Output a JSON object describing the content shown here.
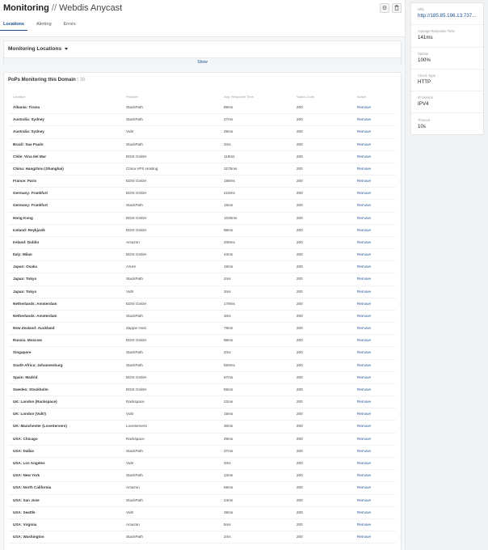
{
  "header": {
    "title": "Monitoring",
    "separator": "//",
    "subtitle": "Webdis Anycast",
    "settings_icon": "gear-icon",
    "delete_icon": "trash-icon",
    "tabs": [
      {
        "label": "Locations",
        "active": true
      },
      {
        "label": "Alerting",
        "active": false
      },
      {
        "label": "Errors",
        "active": false
      }
    ]
  },
  "monitoring": {
    "title": "Monitoring Locations",
    "show_label": "Show"
  },
  "pops": {
    "title": "PoPs Monitoring this Domain",
    "count_sep": "|",
    "count": "38",
    "columns": [
      "Location",
      "Provider",
      "Avg. Response Time",
      "Status Code",
      "Action"
    ],
    "rows": [
      {
        "location": "Albania: Tirana",
        "provider": "StackPath",
        "response": "89ms",
        "status": "200",
        "action": "Remove"
      },
      {
        "location": "Australia: Sydney",
        "provider": "StackPath",
        "response": "27ms",
        "status": "200",
        "action": "Remove"
      },
      {
        "location": "Australia: Sydney",
        "provider": "Vultr",
        "response": "29ms",
        "status": "200",
        "action": "Remove"
      },
      {
        "location": "Brazil: Sao Paulo",
        "provider": "StackPath",
        "response": "2ms",
        "status": "200",
        "action": "Remove"
      },
      {
        "location": "Chile: Vina del Mar",
        "provider": "EDIS GmbH",
        "response": "119ms",
        "status": "200",
        "action": "Remove"
      },
      {
        "location": "China: Hangzhou (Shanghai)",
        "provider": "China VPS Hosting",
        "response": "3275ms",
        "status": "200",
        "action": "Remove"
      },
      {
        "location": "France: Paris",
        "provider": "EDIS GmbH",
        "response": "188ms",
        "status": "200",
        "action": "Remove"
      },
      {
        "location": "Germany: Frankfurt",
        "provider": "EDIS GmbH",
        "response": "216ms",
        "status": "200",
        "action": "Remove"
      },
      {
        "location": "Germany: Frankfurt",
        "provider": "StackPath",
        "response": "15ms",
        "status": "200",
        "action": "Remove"
      },
      {
        "location": "Hong Kong",
        "provider": "EDIS GmbH",
        "response": "1020ms",
        "status": "200",
        "action": "Remove"
      },
      {
        "location": "Iceland: Reykjavik",
        "provider": "EDIS GmbH",
        "response": "98ms",
        "status": "200",
        "action": "Remove"
      },
      {
        "location": "Ireland: Dublin",
        "provider": "Amazon",
        "response": "206ms",
        "status": "200",
        "action": "Remove"
      },
      {
        "location": "Italy: Milan",
        "provider": "EDIS GmbH",
        "response": "43ms",
        "status": "200",
        "action": "Remove"
      },
      {
        "location": "Japan: Osaka",
        "provider": "Azure",
        "response": "19ms",
        "status": "200",
        "action": "Remove"
      },
      {
        "location": "Japan: Tokyo",
        "provider": "StackPath",
        "response": "2ms",
        "status": "200",
        "action": "Remove"
      },
      {
        "location": "Japan: Tokyo",
        "provider": "Vultr",
        "response": "3ms",
        "status": "200",
        "action": "Remove"
      },
      {
        "location": "Netherlands: Amsterdam",
        "provider": "EDIS GmbH",
        "response": "178ms",
        "status": "200",
        "action": "Remove"
      },
      {
        "location": "Netherlands: Amsterdam",
        "provider": "StackPath",
        "response": "3ms",
        "status": "200",
        "action": "Remove"
      },
      {
        "location": "New Zealand: Auckland",
        "provider": "Zappie Host",
        "response": "78ms",
        "status": "200",
        "action": "Remove"
      },
      {
        "location": "Russia: Moscow",
        "provider": "EDIS GmbH",
        "response": "98ms",
        "status": "200",
        "action": "Remove"
      },
      {
        "location": "Singapore",
        "provider": "StackPath",
        "response": "2ms",
        "status": "200",
        "action": "Remove"
      },
      {
        "location": "South Africa: Johannesburg",
        "provider": "StackPath",
        "response": "550ms",
        "status": "200",
        "action": "Remove"
      },
      {
        "location": "Spain: Madrid",
        "provider": "EDIS GmbH",
        "response": "67ms",
        "status": "200",
        "action": "Remove"
      },
      {
        "location": "Sweden: Stockholm",
        "provider": "EDIS GmbH",
        "response": "55ms",
        "status": "200",
        "action": "Remove"
      },
      {
        "location": "UK: London (Rackspace)",
        "provider": "Rackspace",
        "response": "22ms",
        "status": "200",
        "action": "Remove"
      },
      {
        "location": "UK: London (Vultr)",
        "provider": "Vultr",
        "response": "15ms",
        "status": "200",
        "action": "Remove"
      },
      {
        "location": "UK: Manchester (LoveServers)",
        "provider": "LoveServers",
        "response": "30ms",
        "status": "200",
        "action": "Remove"
      },
      {
        "location": "USA: Chicago",
        "provider": "Rackspace",
        "response": "29ms",
        "status": "200",
        "action": "Remove"
      },
      {
        "location": "USA: Dallas",
        "provider": "StackPath",
        "response": "37ms",
        "status": "200",
        "action": "Remove"
      },
      {
        "location": "USA: Los Angeles",
        "provider": "Vultr",
        "response": "2ms",
        "status": "200",
        "action": "Remove"
      },
      {
        "location": "USA: New York",
        "provider": "StackPath",
        "response": "13ms",
        "status": "200",
        "action": "Remove"
      },
      {
        "location": "USA: North California",
        "provider": "Amazon",
        "response": "59ms",
        "status": "200",
        "action": "Remove"
      },
      {
        "location": "USA: San Jose",
        "provider": "StackPath",
        "response": "24ms",
        "status": "200",
        "action": "Remove"
      },
      {
        "location": "USA: Seattle",
        "provider": "Vultr",
        "response": "39ms",
        "status": "200",
        "action": "Remove"
      },
      {
        "location": "USA: Virginia",
        "provider": "Amazon",
        "response": "5ms",
        "status": "200",
        "action": "Remove"
      },
      {
        "location": "USA: Washington",
        "provider": "StackPath",
        "response": "2ms",
        "status": "200",
        "action": "Remove"
      }
    ]
  },
  "sidebar": {
    "items": [
      {
        "label": "URL",
        "value": "http://185.85.196.13:737..."
      },
      {
        "label": "Average Response Time",
        "value": "141ms"
      },
      {
        "label": "Uptime",
        "value": "100%"
      },
      {
        "label": "Check Type",
        "value": "HTTP"
      },
      {
        "label": "IP Version",
        "value": "IPV4"
      },
      {
        "label": "Timeout",
        "value": "10s"
      }
    ]
  },
  "colors": {
    "accent": "#1b4f8e"
  }
}
